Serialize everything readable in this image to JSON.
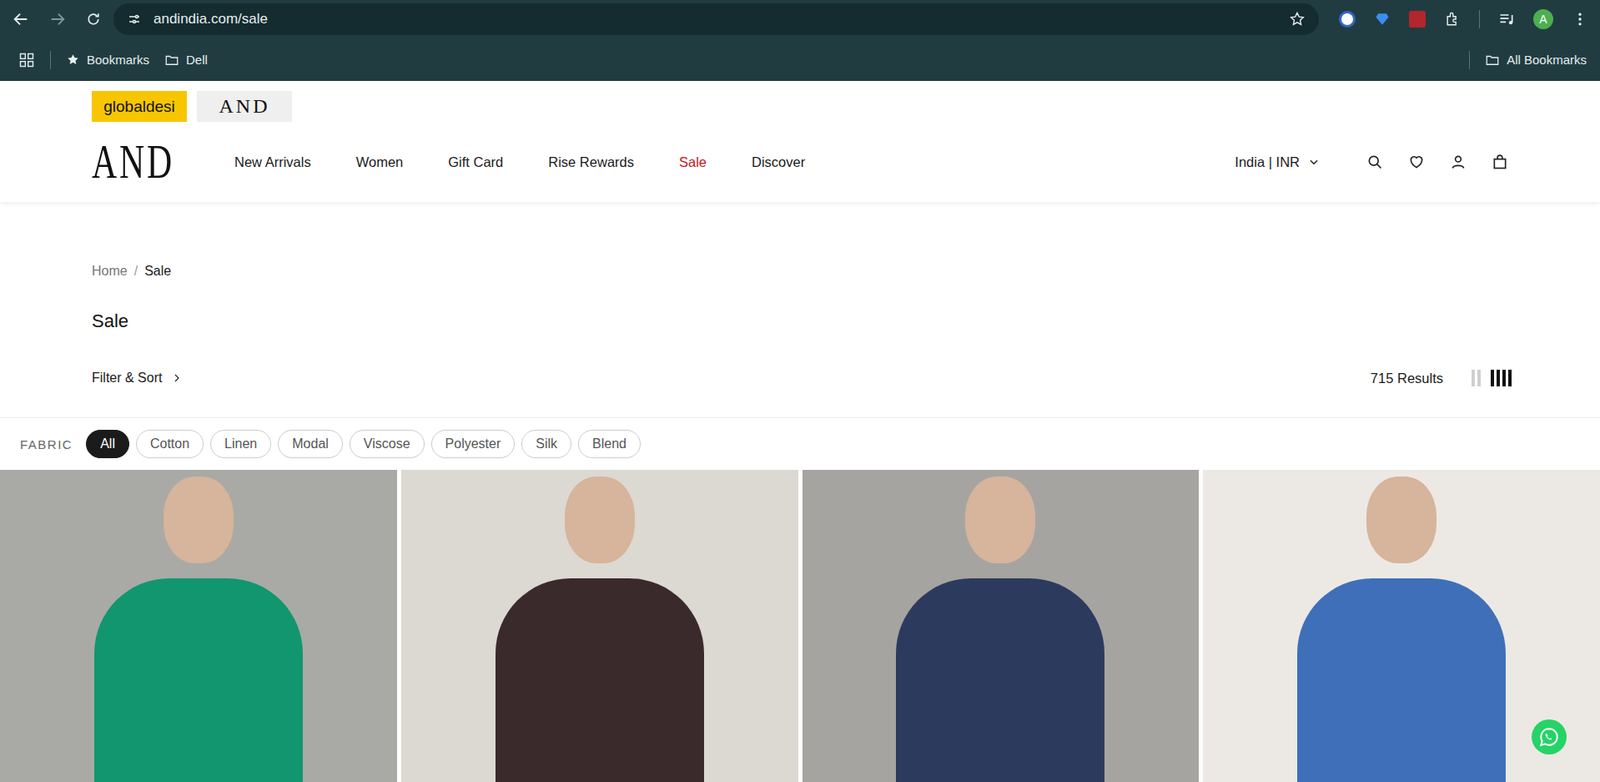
{
  "browser": {
    "url": "andindia.com/sale",
    "bookmarked": false,
    "profile": "A",
    "bookmarks": [
      {
        "label": "Bookmarks",
        "kind": "star"
      },
      {
        "label": "Dell",
        "kind": "folder"
      }
    ],
    "all_bookmarks": "All Bookmarks"
  },
  "site": {
    "brand_tabs": [
      {
        "label": "globaldesi",
        "selected": false,
        "color": "#f7c600"
      },
      {
        "label": "AND",
        "selected": true,
        "color": "#efefef"
      }
    ],
    "logo": "AND",
    "nav": [
      {
        "label": "New Arrivals",
        "selected": false
      },
      {
        "label": "Women",
        "selected": false
      },
      {
        "label": "Gift Card",
        "selected": false
      },
      {
        "label": "Rise Rewards",
        "selected": false
      },
      {
        "label": "Sale",
        "selected": true
      },
      {
        "label": "Discover",
        "selected": false
      }
    ],
    "region": "India | INR"
  },
  "breadcrumb": {
    "items": [
      "Home",
      "Sale"
    ],
    "separator": "/"
  },
  "page_title": "Sale",
  "filter_sort": "Filter & Sort",
  "results": "715 Results",
  "views": [
    {
      "kind": "two",
      "selected": false
    },
    {
      "kind": "four",
      "selected": true
    }
  ],
  "fabric": {
    "label": "FABRIC",
    "chips": [
      {
        "label": "All",
        "selected": true
      },
      {
        "label": "Cotton",
        "selected": false
      },
      {
        "label": "Linen",
        "selected": false
      },
      {
        "label": "Modal",
        "selected": false
      },
      {
        "label": "Viscose",
        "selected": false
      },
      {
        "label": "Polyester",
        "selected": false
      },
      {
        "label": "Silk",
        "selected": false
      },
      {
        "label": "Blend",
        "selected": false
      }
    ]
  },
  "products": [
    {
      "background": "#a9aaa5",
      "garment": "#12966f"
    },
    {
      "background": "#dcd8d2",
      "garment": "#3a2a2c"
    },
    {
      "background": "#a6a4a0",
      "garment": "#2c3a5e"
    },
    {
      "background": "#ece9e5",
      "garment": "#3f6fb8"
    }
  ]
}
